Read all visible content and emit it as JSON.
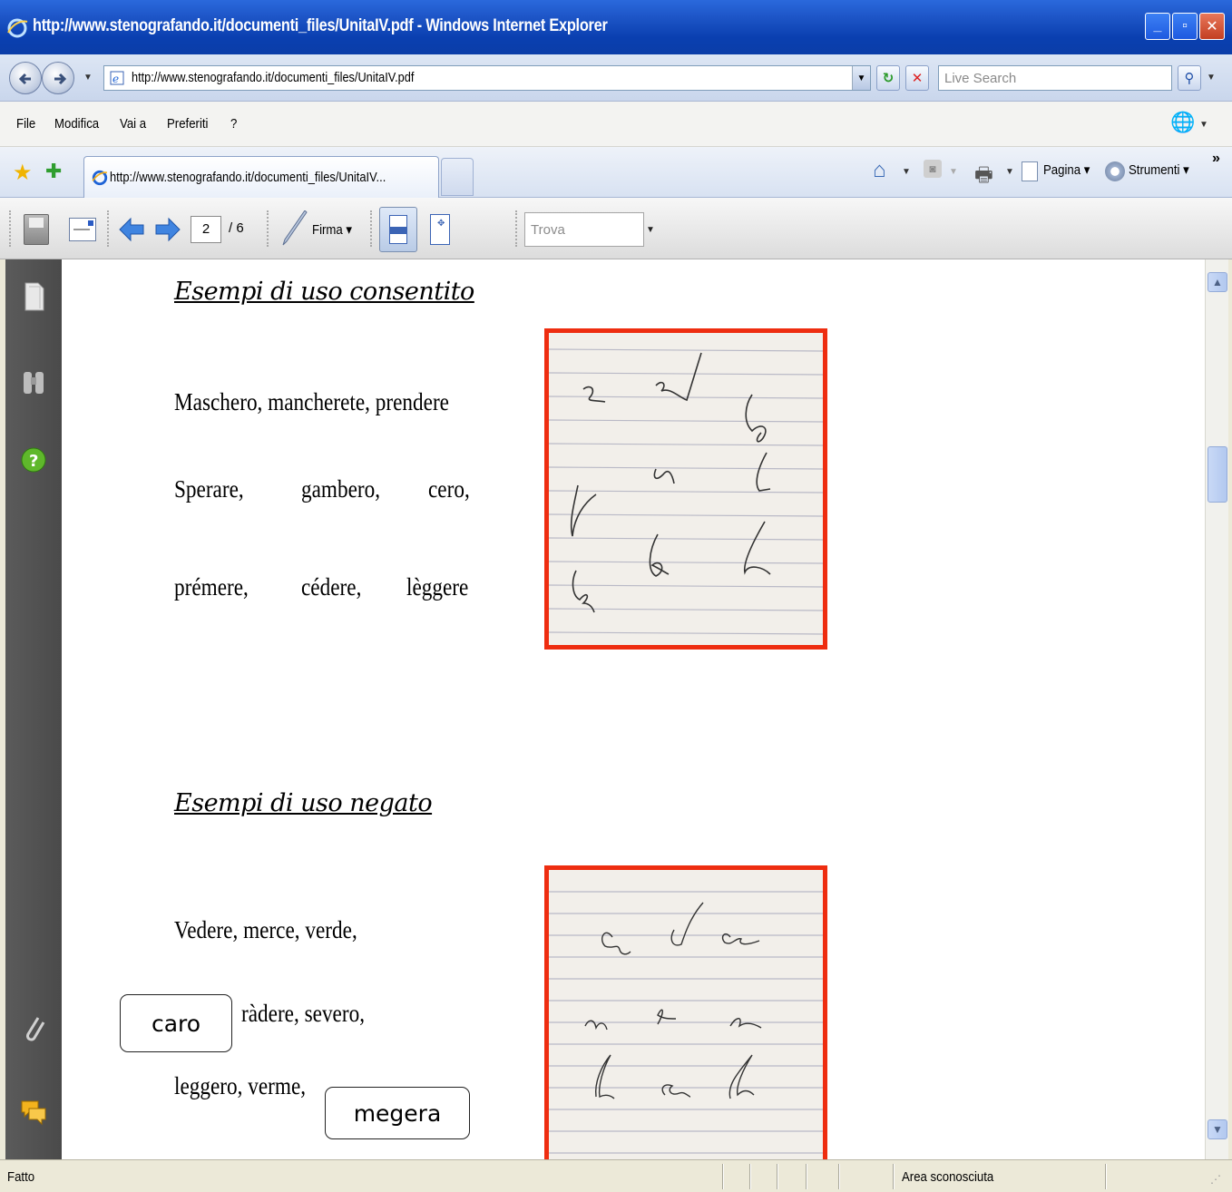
{
  "window": {
    "title": "http://www.stenografando.it/documenti_files/UnitaIV.pdf - Windows Internet Explorer"
  },
  "address_bar": {
    "url": "http://www.stenografando.it/documenti_files/UnitaIV.pdf",
    "search_placeholder": "Live Search"
  },
  "menu": {
    "items": [
      "File",
      "Modifica",
      "Vai a",
      "Preferiti",
      "?"
    ]
  },
  "tabs": [
    {
      "label": "http://www.stenografando.it/documenti_files/UnitaIV..."
    }
  ],
  "command_bar": {
    "pagina": "Pagina",
    "strumenti": "Strumenti",
    "more": "»"
  },
  "pdf_toolbar": {
    "current_page": "2",
    "total_pages": "/ 6",
    "sign_label": "Firma",
    "find_placeholder": "Trova"
  },
  "document": {
    "section1": {
      "heading": "Esempi di uso consentito",
      "lines": [
        [
          "Maschero, mancherete, prendere"
        ],
        [
          "Sperare,",
          "gambero,",
          "cero,"
        ],
        [
          "prémere,",
          "cédere,",
          "lèggere"
        ]
      ]
    },
    "section2": {
      "heading": "Esempi di uso negato",
      "line1": "Vedere, merce,  verde,",
      "line2": "ràdere,  severo,",
      "line3": "leggero, verme,",
      "annotations": [
        "caro",
        "megera"
      ]
    }
  },
  "status_bar": {
    "left": "Fatto",
    "zone": "Area sconosciuta"
  },
  "colors": {
    "titlebar": "#0a3fb0",
    "scan_border": "#ee2d10",
    "sidebar": "#4f4f4f"
  }
}
